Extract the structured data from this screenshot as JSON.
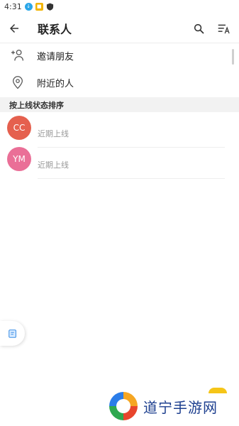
{
  "status_bar": {
    "time": "4:31"
  },
  "header": {
    "title": "联系人"
  },
  "menu": [
    {
      "label": "邀请朋友",
      "icon": "add-person-icon"
    },
    {
      "label": "附近的人",
      "icon": "location-pin-icon"
    }
  ],
  "section": {
    "title": "按上线状态排序"
  },
  "contacts": [
    {
      "initials": "CC",
      "status": "近期上线",
      "color": "#e5604e"
    },
    {
      "initials": "YM",
      "status": "近期上线",
      "color": "#ea6f97"
    }
  ],
  "watermark": {
    "text": "道宁手游网"
  },
  "colors": {
    "accent": "#2aa6e8",
    "section_bg": "#f2f2f2"
  }
}
